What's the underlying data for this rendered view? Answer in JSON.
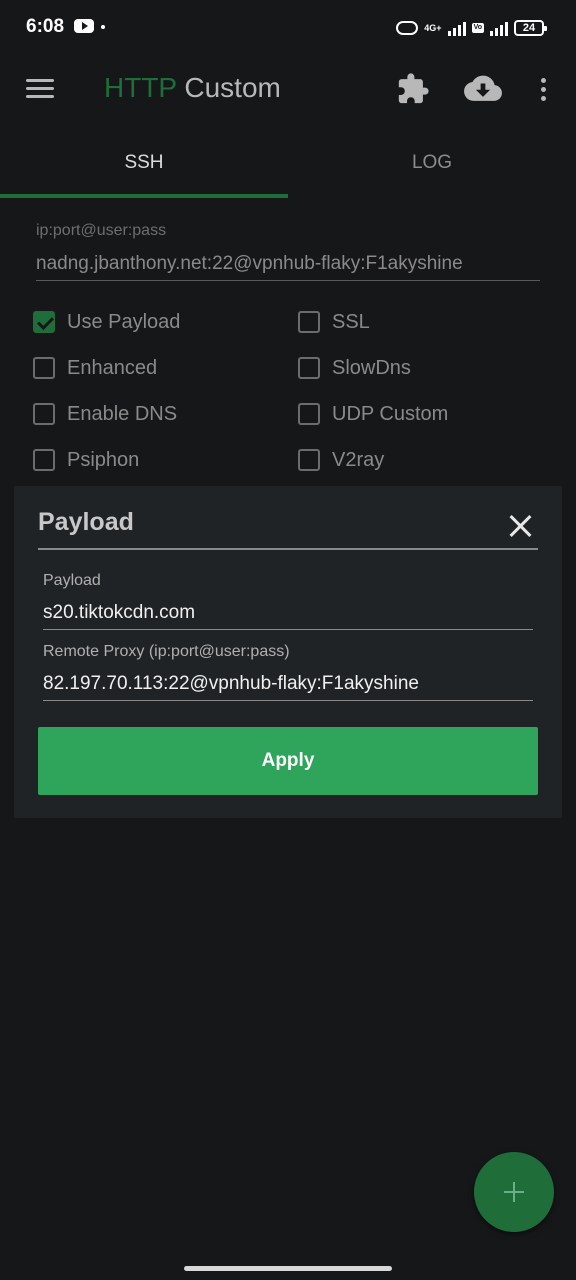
{
  "status_bar": {
    "time": "6:08",
    "network_type": "4G+",
    "battery_level": "24"
  },
  "app_bar": {
    "title_part1": "HTTP",
    "title_part2": " Custom",
    "accent_color": "#1f6e3a"
  },
  "tabs": [
    {
      "label": "SSH",
      "selected": true
    },
    {
      "label": "LOG",
      "selected": false
    }
  ],
  "ssh": {
    "host_placeholder": "ip:port@user:pass",
    "host_value": "nadng.jbanthony.net:22@vpnhub-flaky:F1akyshine"
  },
  "options": [
    {
      "label": "Use Payload",
      "checked": true
    },
    {
      "label": "SSL",
      "checked": false
    },
    {
      "label": "Enhanced",
      "checked": false
    },
    {
      "label": "SlowDns",
      "checked": false
    },
    {
      "label": "Enable DNS",
      "checked": false
    },
    {
      "label": "UDP Custom",
      "checked": false
    },
    {
      "label": "Psiphon",
      "checked": false
    },
    {
      "label": "V2ray",
      "checked": false
    }
  ],
  "dialog": {
    "title": "Payload",
    "payload_label": "Payload",
    "payload_value": "s20.tiktokcdn.com",
    "proxy_label": "Remote Proxy (ip:port@user:pass)",
    "proxy_value": "82.197.70.113:22@vpnhub-flaky:F1akyshine",
    "apply_label": "Apply",
    "apply_color": "#2ea55a"
  },
  "fab": {
    "icon": "plus-icon"
  },
  "icons": {
    "menu": "hamburger-menu-icon",
    "plugin": "puzzle-icon",
    "import": "cloud-download-icon",
    "more": "more-vertical-icon",
    "close": "close-icon"
  }
}
